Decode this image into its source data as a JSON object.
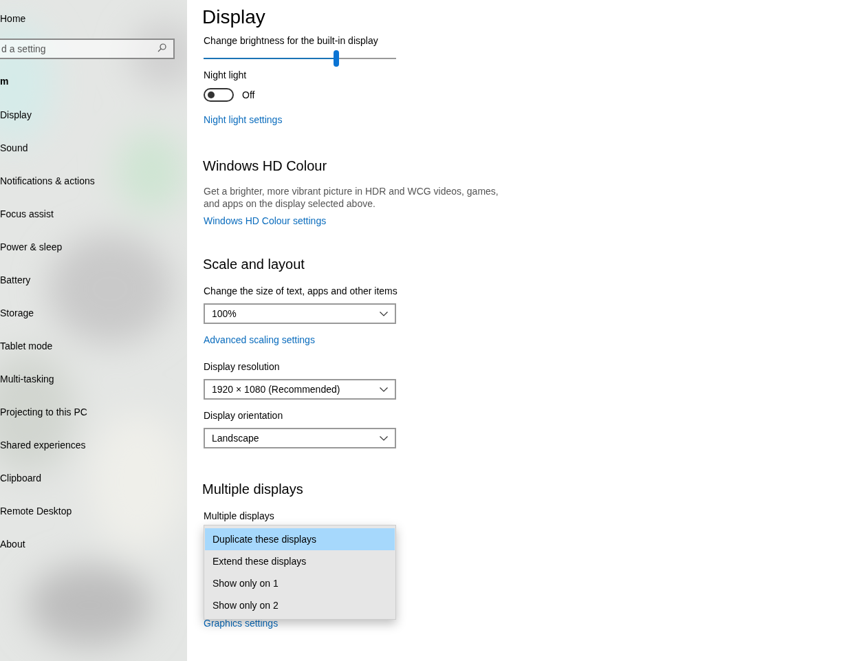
{
  "sidebar": {
    "home": "Home",
    "search": {
      "placeholder": "d a setting"
    },
    "section_title": "m",
    "items": [
      {
        "label": "Display"
      },
      {
        "label": "Sound"
      },
      {
        "label": "Notifications & actions"
      },
      {
        "label": "Focus assist"
      },
      {
        "label": "Power & sleep"
      },
      {
        "label": "Battery"
      },
      {
        "label": "Storage"
      },
      {
        "label": "Tablet mode"
      },
      {
        "label": "Multi-tasking"
      },
      {
        "label": "Projecting to this PC"
      },
      {
        "label": "Shared experiences"
      },
      {
        "label": "Clipboard"
      },
      {
        "label": "Remote Desktop"
      },
      {
        "label": "About"
      }
    ]
  },
  "main": {
    "title": "Display",
    "brightness": {
      "label": "Change brightness for the built-in display",
      "level": 0.69
    },
    "night_light": {
      "label": "Night light",
      "on": false,
      "state_text": "Off",
      "link": "Night light settings"
    },
    "hd_colour": {
      "heading": "Windows HD Colour",
      "description": "Get a brighter, more vibrant picture in HDR and WCG videos, games, and apps on the display selected above.",
      "link": "Windows HD Colour settings"
    },
    "scale": {
      "heading": "Scale and layout",
      "size_label": "Change the size of text, apps and other items",
      "size_value": "100%",
      "advanced_link": "Advanced scaling settings",
      "resolution_label": "Display resolution",
      "resolution_value": "1920 × 1080 (Recommended)",
      "orientation_label": "Display orientation",
      "orientation_value": "Landscape"
    },
    "multiple": {
      "heading": "Multiple displays",
      "label": "Multiple displays",
      "options": [
        {
          "label": "Duplicate these displays",
          "selected": true
        },
        {
          "label": "Extend these displays",
          "selected": false
        },
        {
          "label": "Show only on 1",
          "selected": false
        },
        {
          "label": "Show only on 2",
          "selected": false
        }
      ],
      "graphics_link": "Graphics settings"
    }
  }
}
